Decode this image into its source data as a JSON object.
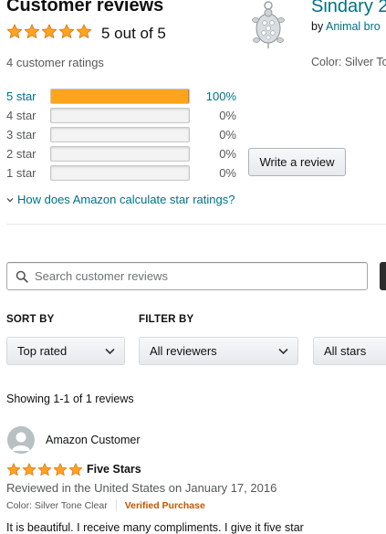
{
  "header": {
    "title": "Customer reviews",
    "average_text": "5 out of 5",
    "average_stars": 5,
    "ratings_count_text": "4 customer ratings"
  },
  "product": {
    "title": "Sindary 2",
    "by_prefix": "by ",
    "brand": "Animal bro",
    "color_line": "Color: Silver To"
  },
  "histogram": [
    {
      "label": "5 star",
      "percent_text": "100%",
      "fill_fraction": 1.0,
      "active": true
    },
    {
      "label": "4 star",
      "percent_text": "0%",
      "fill_fraction": 0,
      "active": false
    },
    {
      "label": "3 star",
      "percent_text": "0%",
      "fill_fraction": 0,
      "active": false
    },
    {
      "label": "2 star",
      "percent_text": "0%",
      "fill_fraction": 0,
      "active": false
    },
    {
      "label": "1 star",
      "percent_text": "0%",
      "fill_fraction": 0,
      "active": false
    }
  ],
  "write_review_label": "Write a review",
  "calc_link_label": "How does Amazon calculate star ratings?",
  "search": {
    "placeholder": "Search customer reviews",
    "value": ""
  },
  "sort": {
    "label": "SORT BY",
    "selected": "Top rated"
  },
  "filter": {
    "label": "FILTER BY",
    "reviewers_selected": "All reviewers",
    "stars_selected": "All stars"
  },
  "showing_text": "Showing 1-1 of 1 reviews",
  "review": {
    "author": "Amazon Customer",
    "stars": 5,
    "title": "Five Stars",
    "date_line": "Reviewed in the United States on January 17, 2016",
    "color_line": "Color: Silver Tone Clear",
    "verified": "Verified Purchase",
    "body": "It is beautiful. I receive many compliments. I give it five star"
  },
  "colors": {
    "star": "#ffa41c",
    "star_border": "#de7921",
    "link": "#007185",
    "verified": "#c45500"
  }
}
